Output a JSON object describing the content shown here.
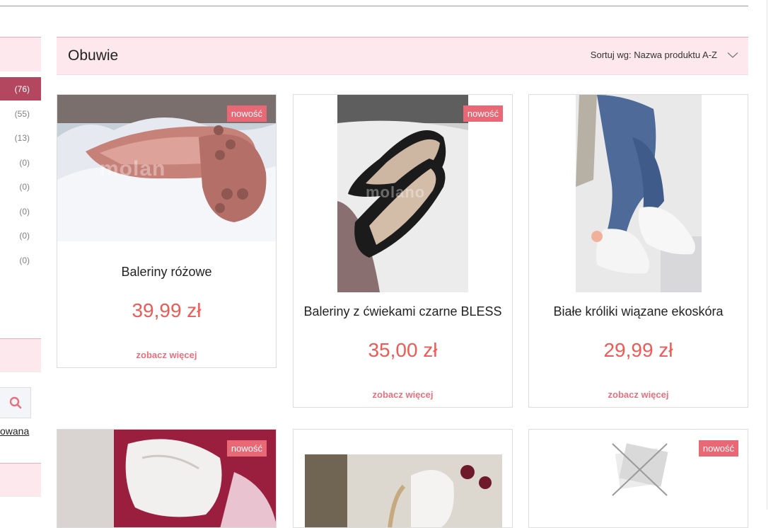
{
  "sidebar": {
    "counts": [
      "(76)",
      "(55)",
      "(13)",
      "(0)",
      "(0)",
      "(0)",
      "(0)",
      "(0)"
    ],
    "link_fragment": "owana",
    "search_icon": "search-icon"
  },
  "header": {
    "title": "Obuwie",
    "sort_label": "Sortuj wg: Nazwa produktu A-Z",
    "sort_icon": "chevron-down-icon"
  },
  "products": [
    {
      "name": "Baleriny różowe",
      "price": "39,99 zł",
      "more": "zobacz więcej",
      "badge": "nowość",
      "watermark": "molan"
    },
    {
      "name": "Baleriny z ćwiekami czarne BLESS",
      "price": "35,00 zł",
      "more": "zobacz więcej",
      "badge": "nowość",
      "watermark": "molano"
    },
    {
      "name": "Białe króliki wiązane ekoskóra",
      "price": "29,99 zł",
      "more": "zobacz więcej",
      "badge": ""
    },
    {
      "badge": "nowość"
    },
    {
      "badge": ""
    },
    {
      "badge": "nowość"
    }
  ],
  "colors": {
    "accent_pink": "#fde8ee",
    "active_category": "#b44760",
    "badge": "#e86876",
    "price": "#f05a55",
    "link": "#e3727e"
  }
}
